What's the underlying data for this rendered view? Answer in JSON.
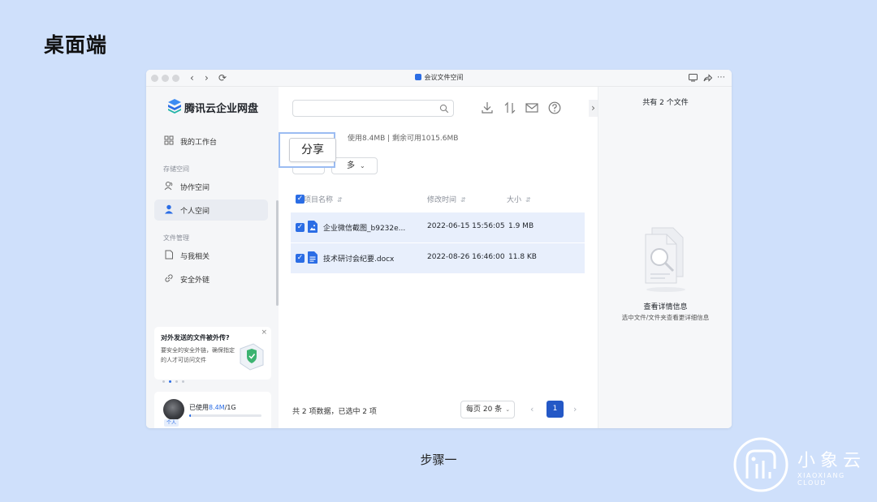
{
  "slide": {
    "title": "桌面端",
    "caption": "步骤一",
    "brand_name": "小象云",
    "brand_sub": "XIAOXIANG CLOUD"
  },
  "window": {
    "title": "会议文件空间",
    "nav_icons": [
      "back-chevron-icon",
      "forward-chevron-icon",
      "refresh-icon"
    ],
    "right_icons": [
      "screen-icon",
      "share-arrow-icon",
      "more-icon"
    ]
  },
  "sidebar": {
    "logo_text": "腾讯云企业网盘",
    "workbench": "我的工作台",
    "storage_section": "存储空间",
    "storage_items": [
      {
        "label": "协作空间",
        "icon": "team-icon"
      },
      {
        "label": "个人空间",
        "icon": "person-icon",
        "active": true
      }
    ],
    "file_section": "文件管理",
    "file_items": [
      {
        "label": "与我相关",
        "icon": "document-icon"
      },
      {
        "label": "安全外链",
        "icon": "link-icon"
      }
    ],
    "promo": {
      "title": "对外发送的文件被外传?",
      "desc": "要安全的安全外链，确保指定的人才可访问文件",
      "close": "×",
      "dots": 4,
      "active_dot": 1
    },
    "user": {
      "usage_prefix": "已使用",
      "usage_used": "8.4M",
      "usage_total": "/1G",
      "usage_fraction": 0.01,
      "tag": "个人"
    }
  },
  "main": {
    "search_placeholder": "",
    "storage_text": "使用8.4MB | 剩余可用1015.6MB",
    "share_label": "分享",
    "more_label": "多",
    "toolbar_icons": [
      "download-icon",
      "sort-icon",
      "mail-icon",
      "help-icon"
    ],
    "columns": {
      "name": "项目名称",
      "modified": "修改时间",
      "size": "大小"
    },
    "rows": [
      {
        "name": "企业微信截图_b9232e...",
        "modified": "2022-06-15 15:56:05",
        "size": "1.9 MB",
        "type": "image",
        "checked": true
      },
      {
        "name": "技术研讨会纪要.docx",
        "modified": "2022-08-26 16:46:00",
        "size": "11.8 KB",
        "type": "doc",
        "checked": true
      }
    ],
    "footer": {
      "count_text": "共 2 项数据，已选中 2 项",
      "page_size": "每页 20 条",
      "page": "1",
      "prev": "‹",
      "next": "›"
    }
  },
  "details": {
    "count": "共有 2 个文件",
    "title": "查看详情信息",
    "subtitle": "选中文件/文件夹查看更详细信息"
  },
  "colors": {
    "background": "#cfe0fb",
    "accent": "#2b6de5",
    "selected_row": "#e8effc",
    "page_active": "#2458c6"
  }
}
